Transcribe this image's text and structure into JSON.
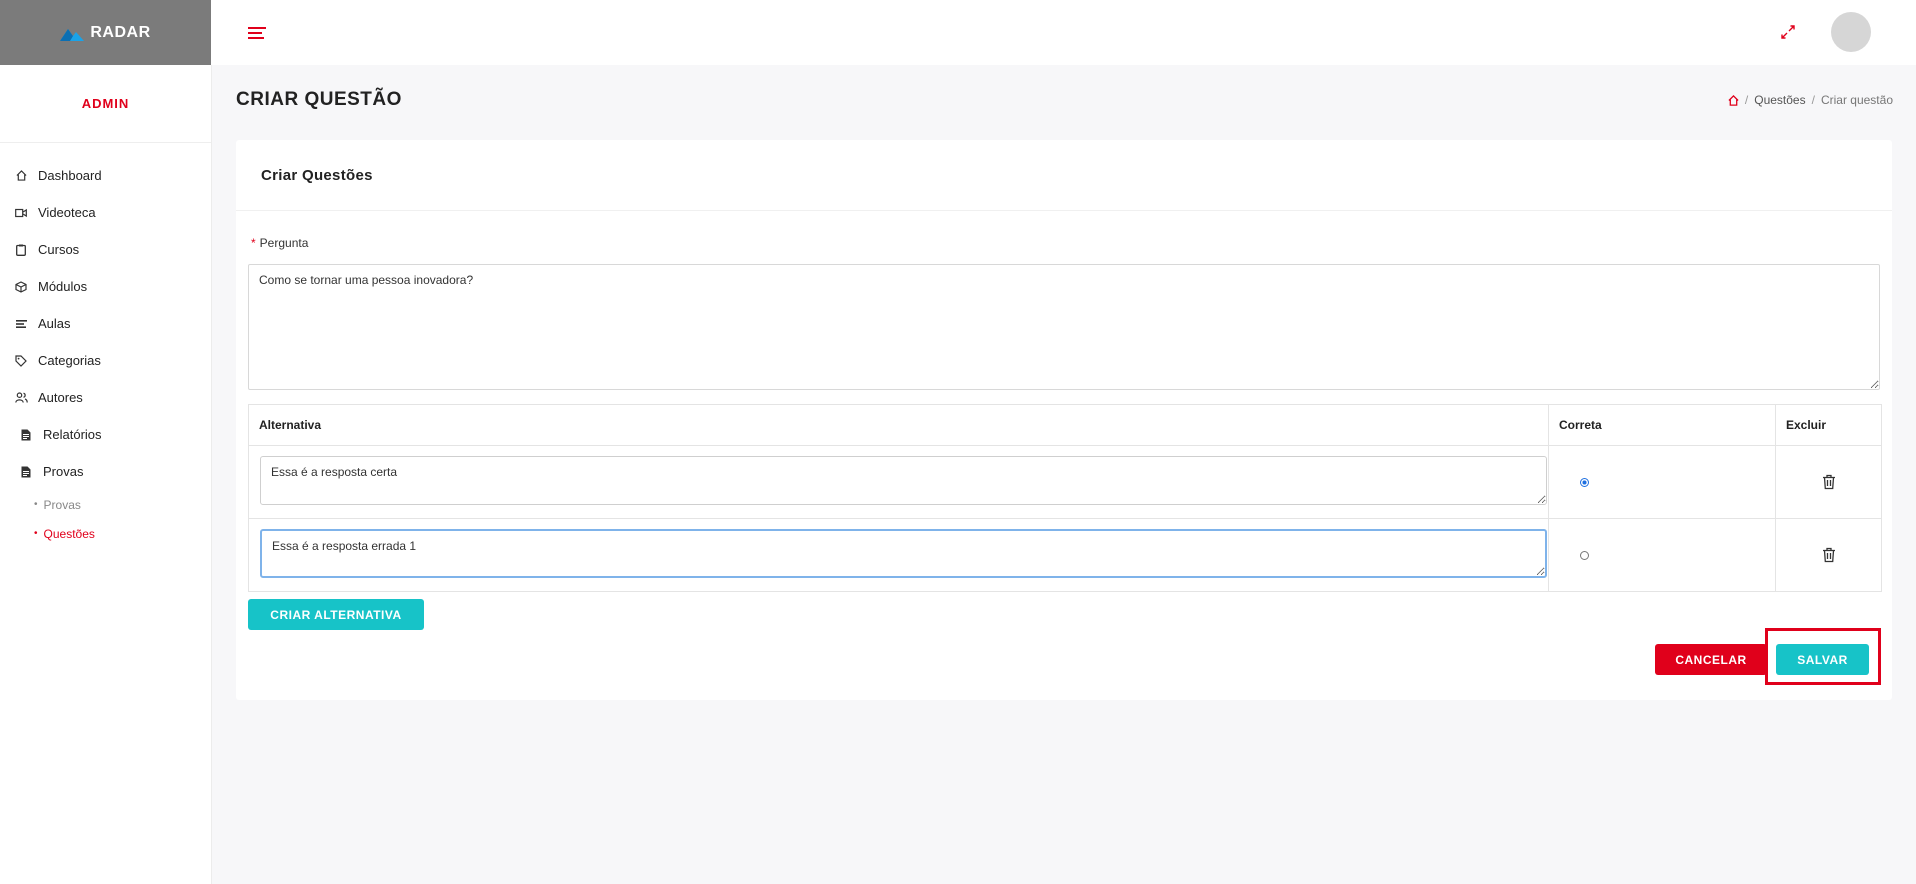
{
  "brand": {
    "name": "RADAR"
  },
  "sidebar": {
    "role": "ADMIN",
    "items": [
      {
        "label": "Dashboard",
        "icon": "home-icon"
      },
      {
        "label": "Videoteca",
        "icon": "video-icon"
      },
      {
        "label": "Cursos",
        "icon": "clipboard-icon"
      },
      {
        "label": "Módulos",
        "icon": "cube-icon"
      },
      {
        "label": "Aulas",
        "icon": "lines-icon"
      },
      {
        "label": "Categorias",
        "icon": "tag-icon"
      },
      {
        "label": "Autores",
        "icon": "users-icon"
      },
      {
        "label": "Relatórios",
        "icon": "document-icon"
      },
      {
        "label": "Provas",
        "icon": "document-icon"
      }
    ],
    "submenu": [
      {
        "label": "Provas"
      },
      {
        "label": "Questões",
        "active": true
      }
    ]
  },
  "header": {
    "title": "CRIAR QUESTÃO",
    "breadcrumb": {
      "sep": "/",
      "section": "Questões",
      "current": "Criar questão"
    }
  },
  "card": {
    "title": "Criar Questões",
    "question_label": "Pergunta",
    "required_mark": "*",
    "question_value": "Como se tornar uma pessoa inovadora?",
    "table": {
      "headers": {
        "alternative": "Alternativa",
        "correct": "Correta",
        "delete": "Excluir"
      },
      "rows": [
        {
          "value": "Essa é a resposta certa",
          "correct": true
        },
        {
          "value": "Essa é a resposta errada 1",
          "correct": false
        }
      ]
    },
    "create_alt_label": "CRIAR ALTERNATIVA",
    "cancel_label": "CANCELAR",
    "save_label": "SALVAR"
  },
  "colors": {
    "accent": "#e0001b",
    "teal": "#17c3c8",
    "brand_bg": "#7b7b7b"
  }
}
